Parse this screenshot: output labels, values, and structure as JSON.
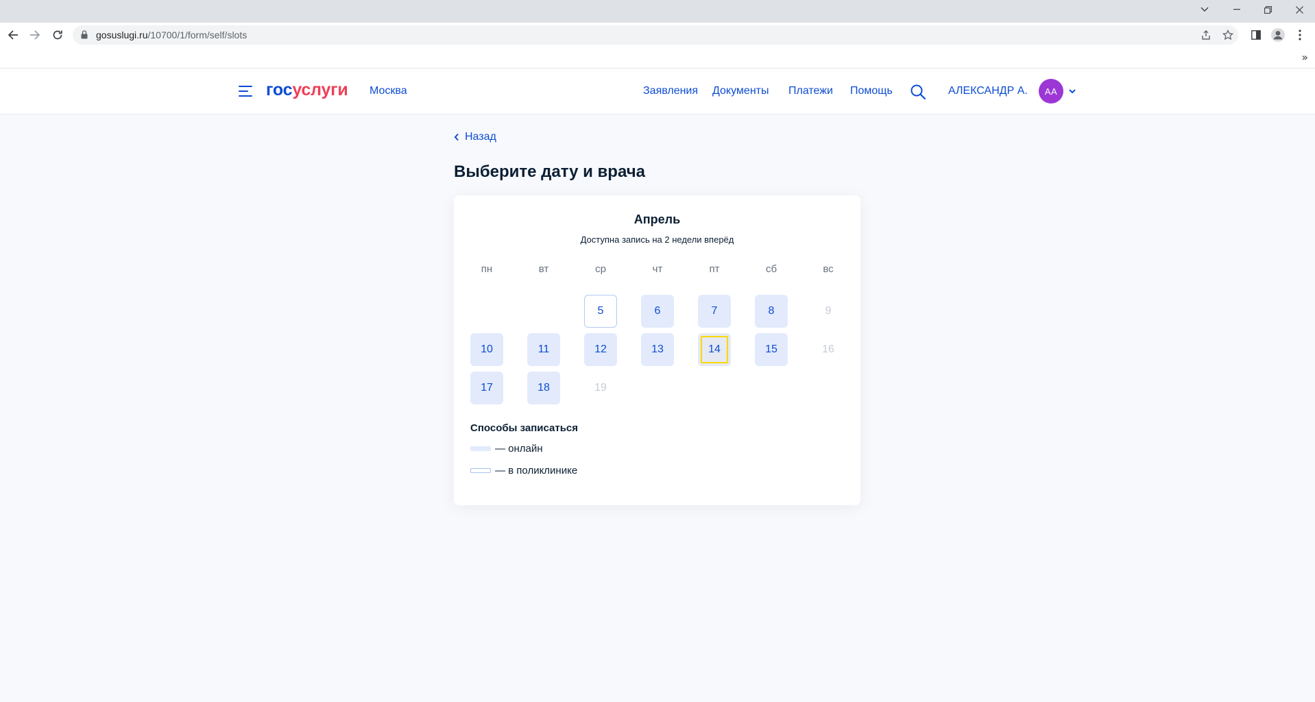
{
  "browser": {
    "url_host": "gosuslugi.ru",
    "url_path": "/10700/1/form/self/slots",
    "bookmarks_overflow": "»"
  },
  "header": {
    "logo_part1": "гос",
    "logo_part2": "услуги",
    "city": "Москва",
    "nav": [
      "Заявления",
      "Документы",
      "Платежи",
      "Помощь"
    ],
    "user_name": "АЛЕКСАНДР А.",
    "avatar_initials": "АА"
  },
  "page": {
    "back_label": "Назад",
    "title": "Выберите дату и врача"
  },
  "calendar": {
    "month": "Апрель",
    "hint": "Доступна запись на 2 недели вперёд",
    "weekdays": [
      "пн",
      "вт",
      "ср",
      "чт",
      "пт",
      "сб",
      "вс"
    ],
    "days": [
      {
        "label": "5",
        "row": 0,
        "col": 2,
        "state": "clinic"
      },
      {
        "label": "6",
        "row": 0,
        "col": 3,
        "state": "online"
      },
      {
        "label": "7",
        "row": 0,
        "col": 4,
        "state": "online"
      },
      {
        "label": "8",
        "row": 0,
        "col": 5,
        "state": "online"
      },
      {
        "label": "9",
        "row": 0,
        "col": 6,
        "state": "off"
      },
      {
        "label": "10",
        "row": 1,
        "col": 0,
        "state": "online"
      },
      {
        "label": "11",
        "row": 1,
        "col": 1,
        "state": "online"
      },
      {
        "label": "12",
        "row": 1,
        "col": 2,
        "state": "online"
      },
      {
        "label": "13",
        "row": 1,
        "col": 3,
        "state": "online"
      },
      {
        "label": "14",
        "row": 1,
        "col": 4,
        "state": "online",
        "selected": true
      },
      {
        "label": "15",
        "row": 1,
        "col": 5,
        "state": "online"
      },
      {
        "label": "16",
        "row": 1,
        "col": 6,
        "state": "off"
      },
      {
        "label": "17",
        "row": 2,
        "col": 0,
        "state": "online"
      },
      {
        "label": "18",
        "row": 2,
        "col": 1,
        "state": "online"
      },
      {
        "label": "19",
        "row": 2,
        "col": 2,
        "state": "off"
      }
    ]
  },
  "legend": {
    "title": "Способы записаться",
    "online": "— онлайн",
    "clinic": "— в поликлинике"
  },
  "colors": {
    "brand_blue": "#0d4cd3",
    "brand_red": "#ee3f58",
    "avatar": "#9c37d6",
    "online_slot": "#e2eafc",
    "focus": "#fcd700"
  }
}
